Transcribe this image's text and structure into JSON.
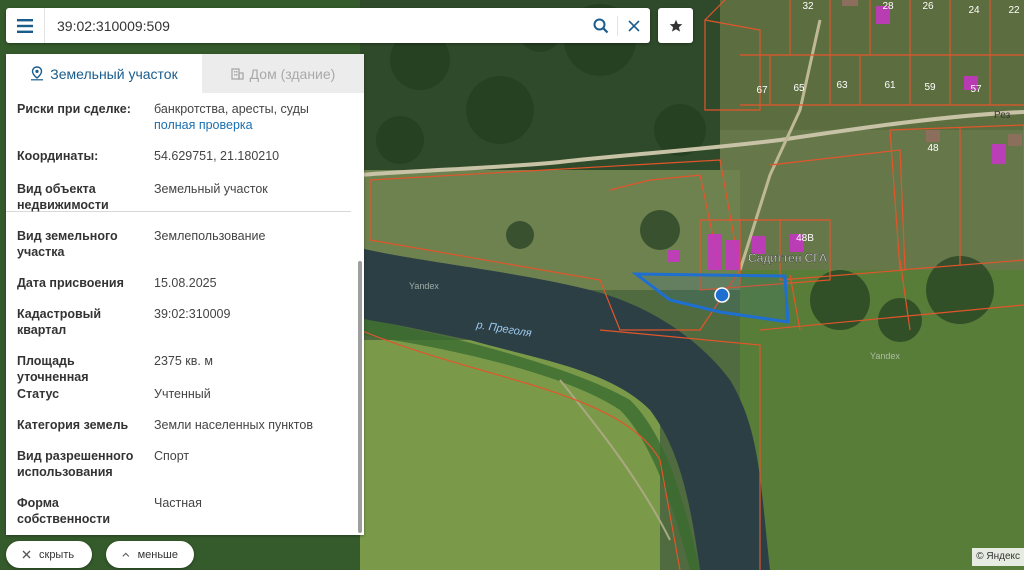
{
  "search": {
    "value": "39:02:310009:509"
  },
  "tabs": [
    {
      "label": "Земельный участок",
      "active": true
    },
    {
      "label": "Дом (здание)",
      "active": false
    }
  ],
  "info": {
    "risks": {
      "key": "Риски при сделке:",
      "value": "банкротства, аресты, суды",
      "link": "полная проверка"
    },
    "coords": {
      "key": "Координаты:",
      "value": "54.629751, 21.180210"
    },
    "object_type": {
      "key": "Вид объекта недвижимости",
      "value": "Земельный участок"
    },
    "land_type": {
      "key": "Вид земельного участка",
      "value": "Землепользование"
    },
    "date": {
      "key": "Дата присвоения",
      "value": "15.08.2025"
    },
    "block": {
      "key": "Кадастровый квартал",
      "value": "39:02:310009"
    },
    "area": {
      "key": "Площадь уточненная",
      "value": "2375 кв. м"
    },
    "status": {
      "key": "Статус",
      "value": "Учтенный"
    },
    "category": {
      "key": "Категория земель",
      "value": "Земли населенных пунктов"
    },
    "usage": {
      "key": "Вид разрешенного использования",
      "value": "Спорт"
    },
    "ownership": {
      "key": "Форма собственности",
      "value": "Частная"
    }
  },
  "buttons": {
    "hide": "скрыть",
    "less": "меньше"
  },
  "map": {
    "river_label": "р. Преголя",
    "watermark": "Yandex",
    "place_label": "Садиттен СГА",
    "parcel_numbers": [
      "32",
      "28",
      "26",
      "24",
      "22",
      "67",
      "65",
      "63",
      "61",
      "59",
      "57",
      "48",
      "48В"
    ],
    "street_label": "Рез",
    "copyright": "© Яндекс"
  },
  "colors": {
    "accent": "#1a5c8c",
    "parcel_border": "#e2552b",
    "selected_parcel": "#1e6fd0",
    "building": "#d02fd0"
  }
}
